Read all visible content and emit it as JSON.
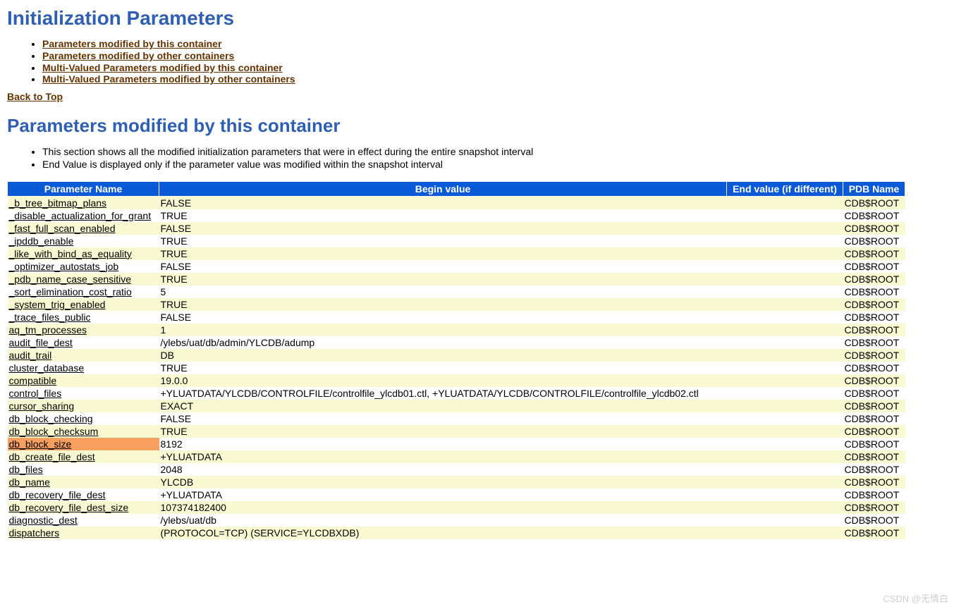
{
  "headings": {
    "main": "Initialization Parameters",
    "section": "Parameters modified by this container"
  },
  "toc": [
    "Parameters modified by this container",
    "Parameters modified by other containers",
    "Multi-Valued Parameters modified by this container",
    "Multi-Valued Parameters modified by other containers"
  ],
  "back_to_top": "Back to Top",
  "notes": [
    "This section shows all the modified initialization parameters that were in effect during the entire snapshot interval",
    "End Value is displayed only if the parameter value was modified within the snapshot interval"
  ],
  "columns": {
    "param": "Parameter Name",
    "begin": "Begin value",
    "end": "End value (if different)",
    "pdb": "PDB Name"
  },
  "col_widths": {
    "param": 215,
    "begin": 805,
    "end": 165,
    "pdb": 88
  },
  "rows": [
    {
      "name": "_b_tree_bitmap_plans",
      "begin": "FALSE",
      "end": "",
      "pdb": "CDB$ROOT"
    },
    {
      "name": "_disable_actualization_for_grant",
      "begin": "TRUE",
      "end": "",
      "pdb": "CDB$ROOT"
    },
    {
      "name": "_fast_full_scan_enabled",
      "begin": "FALSE",
      "end": "",
      "pdb": "CDB$ROOT"
    },
    {
      "name": "_ipddb_enable",
      "begin": "TRUE",
      "end": "",
      "pdb": "CDB$ROOT"
    },
    {
      "name": "_like_with_bind_as_equality",
      "begin": "TRUE",
      "end": "",
      "pdb": "CDB$ROOT"
    },
    {
      "name": "_optimizer_autostats_job",
      "begin": "FALSE",
      "end": "",
      "pdb": "CDB$ROOT"
    },
    {
      "name": "_pdb_name_case_sensitive",
      "begin": "TRUE",
      "end": "",
      "pdb": "CDB$ROOT"
    },
    {
      "name": "_sort_elimination_cost_ratio",
      "begin": "5",
      "end": "",
      "pdb": "CDB$ROOT"
    },
    {
      "name": "_system_trig_enabled",
      "begin": "TRUE",
      "end": "",
      "pdb": "CDB$ROOT"
    },
    {
      "name": "_trace_files_public",
      "begin": "FALSE",
      "end": "",
      "pdb": "CDB$ROOT"
    },
    {
      "name": "aq_tm_processes",
      "begin": "1",
      "end": "",
      "pdb": "CDB$ROOT"
    },
    {
      "name": "audit_file_dest",
      "begin": "/ylebs/uat/db/admin/YLCDB/adump",
      "end": "",
      "pdb": "CDB$ROOT"
    },
    {
      "name": "audit_trail",
      "begin": "DB",
      "end": "",
      "pdb": "CDB$ROOT"
    },
    {
      "name": "cluster_database",
      "begin": "TRUE",
      "end": "",
      "pdb": "CDB$ROOT"
    },
    {
      "name": "compatible",
      "begin": "19.0.0",
      "end": "",
      "pdb": "CDB$ROOT"
    },
    {
      "name": "control_files",
      "begin": "+YLUATDATA/YLCDB/CONTROLFILE/controlfile_ylcdb01.ctl, +YLUATDATA/YLCDB/CONTROLFILE/controlfile_ylcdb02.ctl",
      "end": "",
      "pdb": "CDB$ROOT"
    },
    {
      "name": "cursor_sharing",
      "begin": "EXACT",
      "end": "",
      "pdb": "CDB$ROOT"
    },
    {
      "name": "db_block_checking",
      "begin": "FALSE",
      "end": "",
      "pdb": "CDB$ROOT"
    },
    {
      "name": "db_block_checksum",
      "begin": "TRUE",
      "end": "",
      "pdb": "CDB$ROOT"
    },
    {
      "name": "db_block_size",
      "begin": "8192",
      "end": "",
      "pdb": "CDB$ROOT",
      "highlight": true
    },
    {
      "name": "db_create_file_dest",
      "begin": "+YLUATDATA",
      "end": "",
      "pdb": "CDB$ROOT"
    },
    {
      "name": "db_files",
      "begin": "2048",
      "end": "",
      "pdb": "CDB$ROOT"
    },
    {
      "name": "db_name",
      "begin": "YLCDB",
      "end": "",
      "pdb": "CDB$ROOT"
    },
    {
      "name": "db_recovery_file_dest",
      "begin": "+YLUATDATA",
      "end": "",
      "pdb": "CDB$ROOT"
    },
    {
      "name": "db_recovery_file_dest_size",
      "begin": "107374182400",
      "end": "",
      "pdb": "CDB$ROOT"
    },
    {
      "name": "diagnostic_dest",
      "begin": "/ylebs/uat/db",
      "end": "",
      "pdb": "CDB$ROOT"
    },
    {
      "name": "dispatchers",
      "begin": "(PROTOCOL=TCP) (SERVICE=YLCDBXDB)",
      "end": "",
      "pdb": "CDB$ROOT"
    }
  ],
  "watermark": "CSDN @无情白"
}
